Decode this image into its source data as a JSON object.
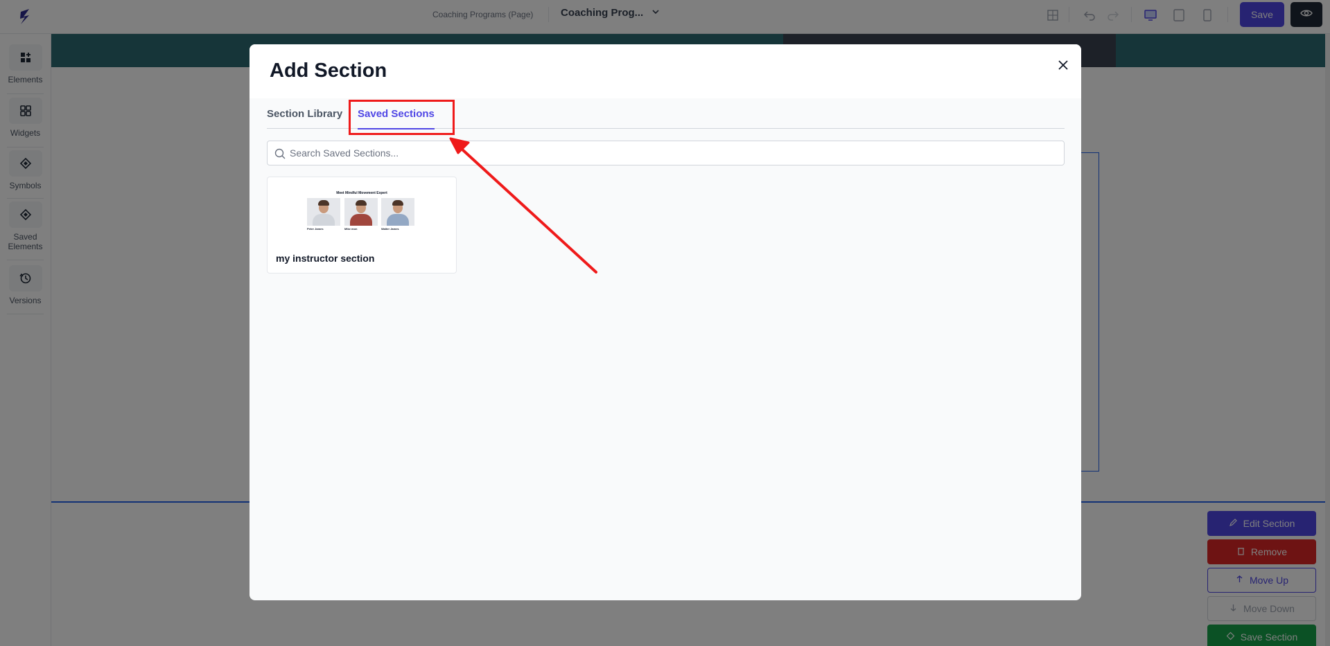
{
  "topbar": {
    "breadcrumb": "Coaching Programs (Page)",
    "page_select": "Coaching Prog...",
    "save_label": "Save"
  },
  "sidebar": {
    "items": [
      {
        "label": "Elements",
        "icon": "elements-icon"
      },
      {
        "label": "Widgets",
        "icon": "widgets-icon"
      },
      {
        "label": "Symbols",
        "icon": "symbols-icon"
      },
      {
        "label": "Saved Elements",
        "icon": "saved-elements-icon"
      },
      {
        "label": "Versions",
        "icon": "versions-icon"
      }
    ]
  },
  "section_controls": {
    "edit": "Edit Section",
    "remove": "Remove",
    "move_up": "Move Up",
    "move_down": "Move Down",
    "save": "Save Section"
  },
  "modal": {
    "title": "Add Section",
    "tabs": [
      {
        "label": "Section Library",
        "active": false
      },
      {
        "label": "Saved Sections",
        "active": true
      }
    ],
    "search": {
      "placeholder": "Search Saved Sections...",
      "value": ""
    },
    "cards": [
      {
        "label": "my instructor section",
        "thumbnail_title": "Meet Mindful Movement Expert",
        "thumbnail_people": [
          "Peter James",
          "Mike mon",
          "Walter James"
        ]
      }
    ]
  },
  "colors": {
    "accent": "#4f46e5",
    "annotation_red": "#ef1a1a",
    "remove_red": "#dc2626",
    "save_green": "#16a34a"
  }
}
